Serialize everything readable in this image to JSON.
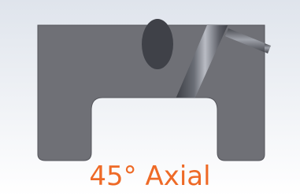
{
  "caption": {
    "text": "45° Axial",
    "color": "#ee6a27"
  },
  "scene": {
    "background_top": "#dfe4ec",
    "background_bottom": "#ffffff",
    "part_color": "#6f7076",
    "part_edge_color": "#55565c",
    "hole_color": "#3f4148",
    "rod_color": "#5e6068",
    "rod_highlight": "#b9bcc4",
    "rod_shadow": "#3a3c42"
  }
}
